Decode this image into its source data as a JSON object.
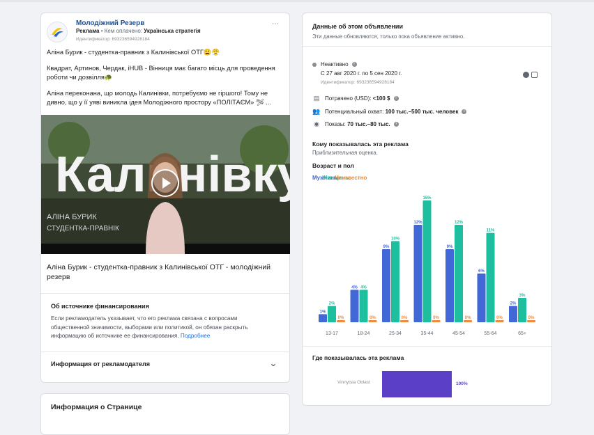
{
  "ad": {
    "page_name": "Молодіжний Резерв",
    "sponsored_label": "Реклама",
    "paid_by_prefix": "• Кем оплачено:",
    "paid_by": "Українська стратегія",
    "id_text": "Идентификатор: 693236594928184",
    "more_icon": "⋯",
    "body": [
      "Аліна Бурик - студентка-правник з Калинівської ОТГ😩😤",
      "Квадрат, Артинов, Чердак, iHUB - Вінниця має багато місць для проведення роботи чи дозвілля🐢",
      "Аліна переконана, що молодь Калинівки, потребуємо не гіршого! Тому не дивно, що у її уяві виникла ідея Молодіжного простору «ПОЛІТАЄМ» 🛩 ..."
    ],
    "video": {
      "overlay_word": "Калинівку",
      "caption_line1": "АЛІНА БУРИК",
      "caption_line2": "СТУДЕНТКА-ПРАВНІК"
    },
    "video_title": "Аліна Бурик - студентка-правник з Калинівської ОТГ - молодіжний резерв",
    "funding": {
      "title": "Об источнике финансирования",
      "text": "Если рекламодатель указывает, что его реклама связана с вопросами общественной значимости, выборами или политикой, он обязан раскрыть информацию об источнике ее финансирования.",
      "link": "Подробнее"
    },
    "advertiser_info": "Информация от рекламодателя",
    "page_info": "Информация о Странице"
  },
  "details": {
    "title": "Данные об этом объявлении",
    "subtitle": "Эти данные обновляются, только пока объявление активно.",
    "status": "Неактивно",
    "dates": "С 27 авг 2020 г. по 5 сен 2020 г.",
    "id_text": "Идентификатор: 693236594928184",
    "spent_label": "Потрачено (USD):",
    "spent_value": "<100 $",
    "reach_label": "Потенциальный охват:",
    "reach_value": "100 тыс.–500 тыс. человек",
    "impr_label": "Показы:",
    "impr_value": "70 тыс.–80 тыс.",
    "who_title": "Кому показывалась эта реклама",
    "who_sub": "Приблизительная оценка.",
    "age_title": "Возраст и пол",
    "legend": {
      "men": "Мужчины",
      "women": "Женщины",
      "unknown": "Неизвестно"
    },
    "colors": {
      "men": "#4267d6",
      "women": "#1ebf9f",
      "unknown": "#f08a3c",
      "region": "#5b3fc7"
    },
    "where_title": "Где показывалась эта реклама",
    "region_name": "Vinnytsia Oblast",
    "region_pct": "100%",
    "region_share": 1.0
  },
  "chart_data": {
    "type": "bar",
    "categories": [
      "13-17",
      "18-24",
      "25-34",
      "35-44",
      "45-54",
      "55-64",
      "65+"
    ],
    "series": [
      {
        "name": "Мужчины",
        "values": [
          1,
          4,
          9,
          12,
          9,
          6,
          2
        ]
      },
      {
        "name": "Женщины",
        "values": [
          2,
          4,
          10,
          15,
          12,
          11,
          3
        ]
      },
      {
        "name": "Неизвестно",
        "values": [
          0,
          0,
          0,
          0,
          0,
          0,
          0
        ]
      }
    ],
    "value_suffix": "%",
    "ylim": [
      0,
      15
    ],
    "grid": false,
    "legend": "top-left"
  }
}
